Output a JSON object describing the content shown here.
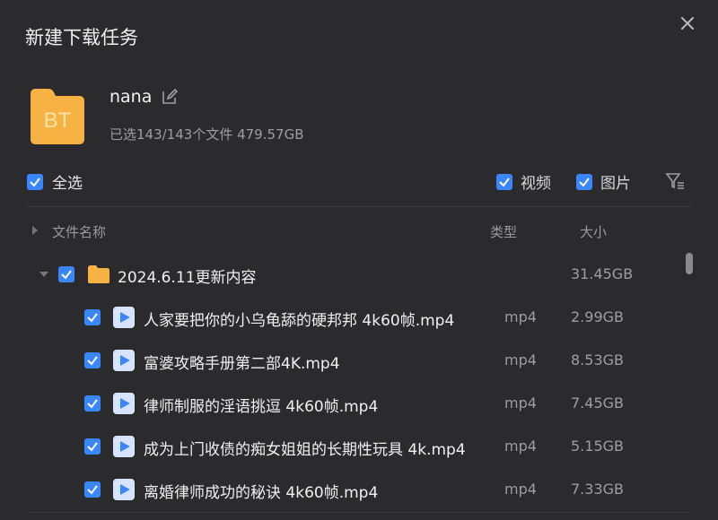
{
  "dialog": {
    "title": "新建下载任务"
  },
  "task": {
    "badge": "BT",
    "name": "nana",
    "summary": "已选143/143个文件 479.57GB"
  },
  "filters": {
    "select_all": "全选",
    "video": "视频",
    "image": "图片"
  },
  "table": {
    "headers": {
      "name": "文件名称",
      "type": "类型",
      "size": "大小"
    }
  },
  "folder": {
    "name": "2024.6.11更新内容",
    "size": "31.45GB"
  },
  "files": [
    {
      "name": "人家要把你的小乌龟舔的硬邦邦 4k60帧.mp4",
      "type": "mp4",
      "size": "2.99GB"
    },
    {
      "name": "富婆攻略手册第二部4K.mp4",
      "type": "mp4",
      "size": "8.53GB"
    },
    {
      "name": "律师制服的淫语挑逗 4k60帧.mp4",
      "type": "mp4",
      "size": "7.45GB"
    },
    {
      "name": "成为上门收债的痴女姐姐的长期性玩具 4k.mp4",
      "type": "mp4",
      "size": "5.15GB"
    },
    {
      "name": "离婚律师成功的秘诀 4k60帧.mp4",
      "type": "mp4",
      "size": "7.33GB"
    }
  ],
  "colors": {
    "accent": "#3a86ff",
    "folder": "#f6b343",
    "background": "#2b2b2e"
  }
}
